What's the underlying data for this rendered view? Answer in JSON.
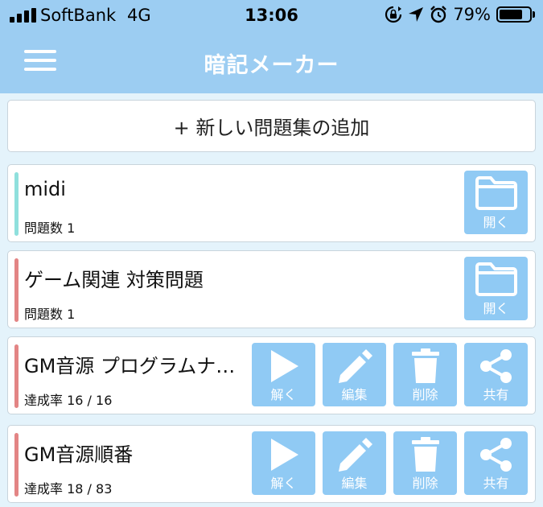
{
  "statusbar": {
    "carrier": "SoftBank",
    "network": "4G",
    "time": "13:06",
    "battery_text": "79%",
    "battery_level": 0.79
  },
  "navbar": {
    "title": "暗記メーカー"
  },
  "add_button": {
    "label": "+ 新しい問題集の追加"
  },
  "colors": {
    "accent": "#9ccdf2",
    "action_button": "#90caf4",
    "bar_teal": "#8fe0dd",
    "bar_red": "#e38585",
    "background": "#e4f3fb"
  },
  "cards": [
    {
      "title": "midi",
      "subtitle": "問題数 1",
      "bar": "teal",
      "actions": [
        {
          "icon": "folder-icon",
          "label": "開く"
        }
      ]
    },
    {
      "title": "ゲーム関連 対策問題",
      "subtitle": "問題数 1",
      "bar": "red",
      "actions": [
        {
          "icon": "folder-icon",
          "label": "開く"
        }
      ]
    },
    {
      "title": "GM音源 プログラムナンバー",
      "subtitle": "達成率 16 / 16",
      "bar": "red",
      "actions": [
        {
          "icon": "play-icon",
          "label": "解く"
        },
        {
          "icon": "pencil-icon",
          "label": "編集"
        },
        {
          "icon": "trash-icon",
          "label": "削除"
        },
        {
          "icon": "share-icon",
          "label": "共有"
        }
      ]
    },
    {
      "title": "GM音源順番",
      "subtitle": "達成率 18 / 83",
      "bar": "red",
      "actions": [
        {
          "icon": "play-icon",
          "label": "解く"
        },
        {
          "icon": "pencil-icon",
          "label": "編集"
        },
        {
          "icon": "trash-icon",
          "label": "削除"
        },
        {
          "icon": "share-icon",
          "label": "共有"
        }
      ]
    }
  ]
}
